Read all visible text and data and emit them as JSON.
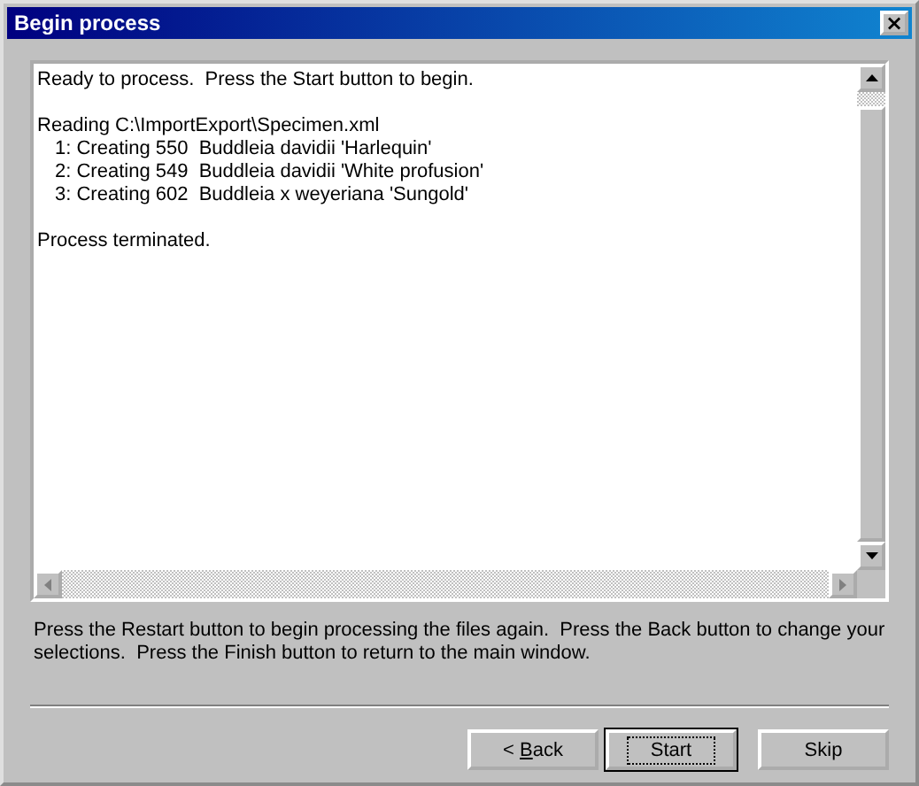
{
  "window": {
    "title": "Begin process",
    "close": "×"
  },
  "log": [
    {
      "text": "Ready to process.  Press the Start button to begin."
    },
    {
      "text": "Reading C:\\ImportExport\\Specimen.xml",
      "children": [
        {
          "number": "1:",
          "text": "Creating 550  Buddleia davidii 'Harlequin'"
        },
        {
          "number": "2:",
          "text": "Creating 549  Buddleia davidii 'White profusion'"
        },
        {
          "number": "3:",
          "text": "Creating 602  Buddleia x weyeriana 'Sungold'"
        }
      ]
    },
    {
      "text": "Process terminated."
    }
  ],
  "instructions": "Press the Restart button to begin processing the files again.  Press the Back button to change your selections.  Press the Finish button to return to the main window.",
  "buttons": [
    {
      "before": "< ",
      "mnemonic": "B",
      "after": "ack",
      "default": false,
      "focused": false
    },
    {
      "before": "Start",
      "default": true,
      "focused": true
    },
    {
      "before": "Skip",
      "default": false,
      "focused": false
    }
  ]
}
